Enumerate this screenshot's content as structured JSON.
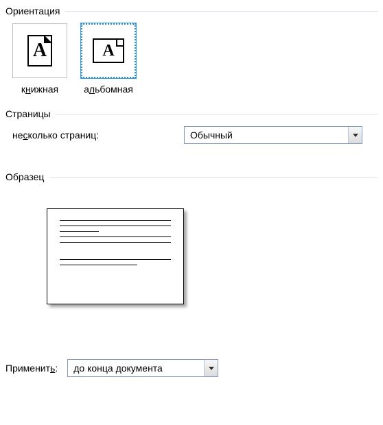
{
  "orientation": {
    "title": "Ориентация",
    "portrait_label_pre": "к",
    "portrait_label_u": "н",
    "portrait_label_post": "ижная",
    "landscape_label_pre": "а",
    "landscape_label_u": "л",
    "landscape_label_post": "ьбомная",
    "glyphA": "A"
  },
  "pages": {
    "title": "Страницы",
    "multiple_label_pre": "не",
    "multiple_label_u": "с",
    "multiple_label_post": "колько страниц:",
    "multiple_value": "Обычный"
  },
  "sample": {
    "title": "Образец"
  },
  "apply": {
    "label_pre": "Применит",
    "label_u": "ь",
    "label_post": ":",
    "value": "до конца документа"
  }
}
